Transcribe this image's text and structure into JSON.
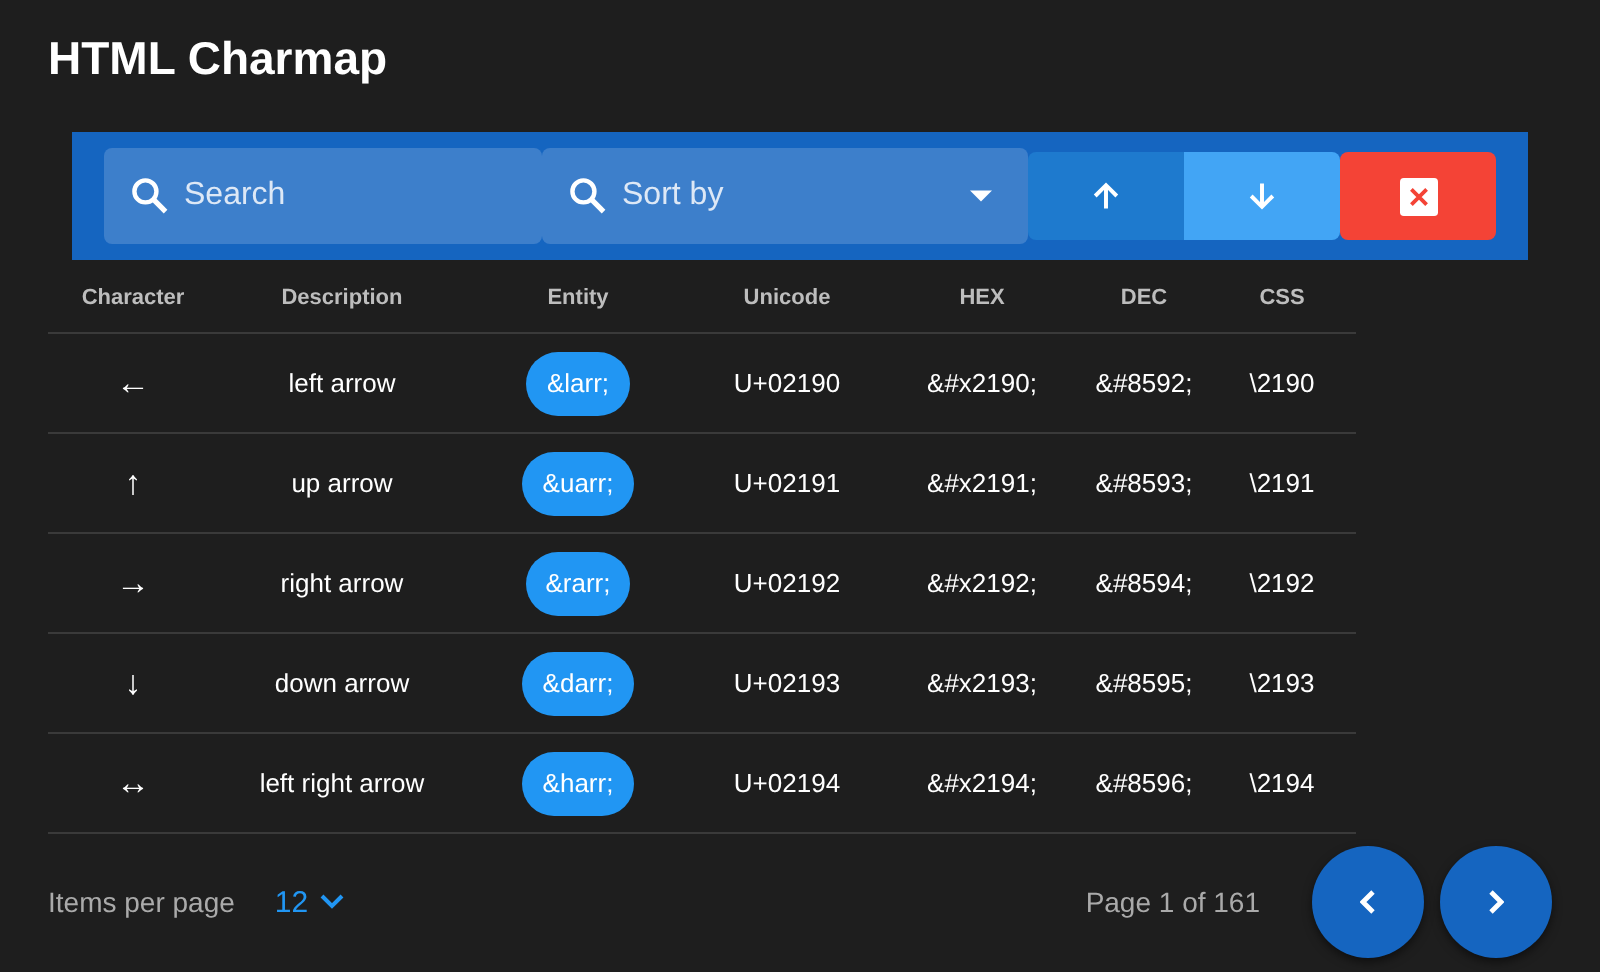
{
  "title": "HTML Charmap",
  "toolbar": {
    "search": {
      "placeholder": "Search"
    },
    "sort": {
      "placeholder": "Sort by"
    },
    "sort_order": [
      {
        "kind": "up",
        "selected": false
      },
      {
        "kind": "down",
        "selected": true
      }
    ]
  },
  "table": {
    "columns": [
      "Character",
      "Description",
      "Entity",
      "Unicode",
      "HEX",
      "DEC",
      "CSS"
    ],
    "rows": [
      {
        "character": "←",
        "description": "left arrow",
        "entity": "&larr;",
        "unicode": "U+02190",
        "hex": "&#x2190;",
        "dec": "&#8592;",
        "css": "\\2190"
      },
      {
        "character": "↑",
        "description": "up arrow",
        "entity": "&uarr;",
        "unicode": "U+02191",
        "hex": "&#x2191;",
        "dec": "&#8593;",
        "css": "\\2191"
      },
      {
        "character": "→",
        "description": "right arrow",
        "entity": "&rarr;",
        "unicode": "U+02192",
        "hex": "&#x2192;",
        "dec": "&#8594;",
        "css": "\\2192"
      },
      {
        "character": "↓",
        "description": "down arrow",
        "entity": "&darr;",
        "unicode": "U+02193",
        "hex": "&#x2193;",
        "dec": "&#8595;",
        "css": "\\2193"
      },
      {
        "character": "↔",
        "description": "left right arrow",
        "entity": "&harr;",
        "unicode": "U+02194",
        "hex": "&#x2194;",
        "dec": "&#8596;",
        "css": "\\2194"
      }
    ]
  },
  "footer": {
    "items_per_page_label": "Items per page",
    "items_per_page": "12",
    "page_info": "Page 1 of 161"
  }
}
